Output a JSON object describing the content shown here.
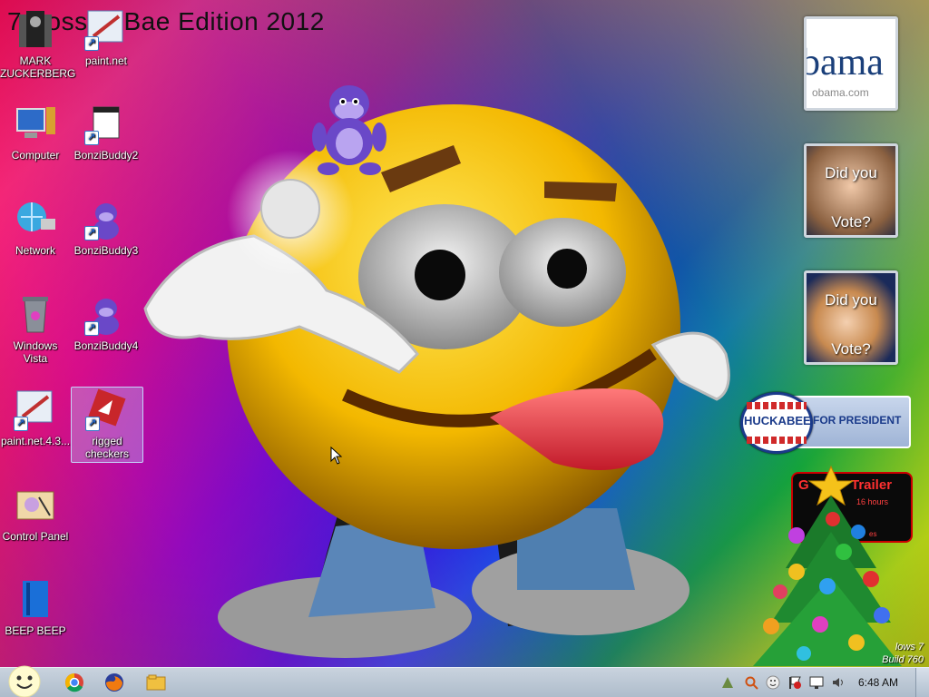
{
  "wallpaper": {
    "edition_title": "7 PossumBae Edition 2012"
  },
  "desktop_icons": [
    {
      "label": "MARK ZUCKERBERG",
      "icon": "folder-person-icon"
    },
    {
      "label": "paint.net",
      "icon": "paint-net-icon"
    },
    {
      "label": "Computer",
      "icon": "computer-icon"
    },
    {
      "label": "BonziBuddy2",
      "icon": "document-icon"
    },
    {
      "label": "Network",
      "icon": "network-icon"
    },
    {
      "label": "BonziBuddy3",
      "icon": "bonzi-buddy-icon"
    },
    {
      "label": "Windows Vista",
      "icon": "recycle-bin-icon"
    },
    {
      "label": "BonziBuddy4",
      "icon": "bonzi-buddy-icon"
    },
    {
      "label": "paint.net.4.3...",
      "icon": "paint-net-icon"
    },
    {
      "label": "rigged checkers",
      "icon": "checkers-icon"
    },
    {
      "label": "Control Panel",
      "icon": "control-panel-icon"
    },
    {
      "label": "BEEP BEEP",
      "icon": "blue-book-icon"
    }
  ],
  "gadgets": {
    "obama": {
      "headline": "bama",
      "url": "obama.com"
    },
    "mccain": {
      "line1": "Did you",
      "line2": "Vote?"
    },
    "clinton": {
      "line1": "Did you",
      "line2": "Vote?"
    },
    "huckabee": {
      "name": "HUCKABEE",
      "tagline": "FOR PRESIDENT"
    },
    "trailer": {
      "title": "Trailer",
      "prefix": "G",
      "detail": "16 hours",
      "footer": "es"
    },
    "watermark": {
      "line1": "lows 7",
      "line2": "Build 760"
    }
  },
  "taskbar": {
    "clock": "6:48 AM",
    "pinned": [
      "start-orb-smiley-icon",
      "chrome-icon",
      "firefox-icon",
      "explorer-folder-icon"
    ],
    "tray": [
      "network-tray-icon",
      "search-tray-icon",
      "smiley-tray-icon",
      "flag-tray-icon",
      "monitor-tray-icon",
      "volume-icon"
    ]
  },
  "colors": {
    "taskbar": "#b4c1ce",
    "smiley_yellow": "#f5c20c",
    "huckabee_blue": "#1a3a8a"
  }
}
